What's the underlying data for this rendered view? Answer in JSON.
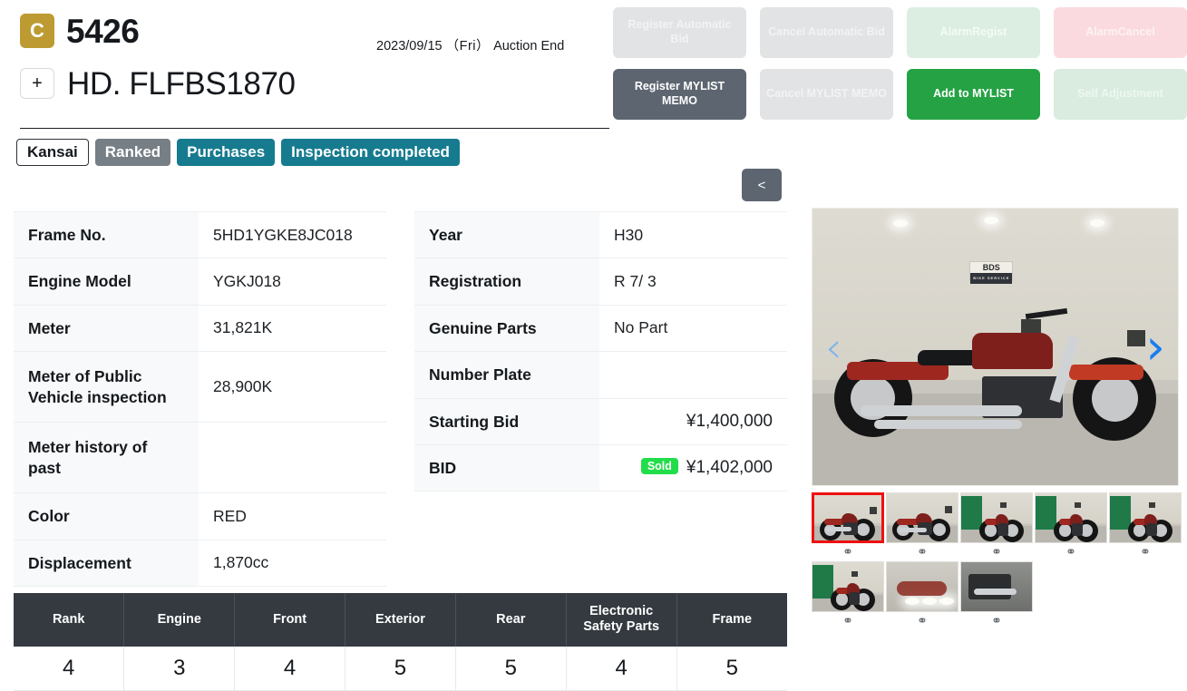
{
  "header": {
    "grade_badge": "C",
    "lot_number": "5426",
    "expand_button": "+",
    "model_name": "HD. FLFBS1870",
    "auction_date": "2023/09/15",
    "auction_day": "（Fri）",
    "auction_status": "Auction End"
  },
  "actions": [
    {
      "label": "Register Automatic Bid",
      "style": "act-grey",
      "name": "register-automatic-bid-button"
    },
    {
      "label": "Cancel Automatic Bid",
      "style": "act-grey",
      "name": "cancel-automatic-bid-button"
    },
    {
      "label": "AlarmRegist",
      "style": "act-green-l",
      "name": "alarm-regist-button"
    },
    {
      "label": "AlarmCancel",
      "style": "act-pink",
      "name": "alarm-cancel-button"
    },
    {
      "label": "Register MYLIST MEMO",
      "style": "act-dark",
      "name": "register-mylist-memo-button"
    },
    {
      "label": "Cancel MYLIST MEMO",
      "style": "act-grey",
      "name": "cancel-mylist-memo-button"
    },
    {
      "label": "Add to MYLIST",
      "style": "act-green",
      "name": "add-to-mylist-button"
    },
    {
      "label": "Self Adjustment",
      "style": "act-green-l2",
      "name": "self-adjustment-button"
    }
  ],
  "tags": [
    {
      "label": "Kansai",
      "style": "tag-outline",
      "name": "tag-region"
    },
    {
      "label": "Ranked",
      "style": "tag-grey",
      "name": "tag-ranked"
    },
    {
      "label": "Purchases",
      "style": "tag-teal",
      "name": "tag-purchases"
    },
    {
      "label": "Inspection completed",
      "style": "tag-teal",
      "name": "tag-inspection-completed"
    }
  ],
  "collapse_button": "<",
  "spec_left": [
    {
      "key": "Frame No.",
      "value": "5HD1YGKE8JC018",
      "tall": false
    },
    {
      "key": "Engine Model",
      "value": "YGKJ018",
      "tall": false
    },
    {
      "key": "Meter",
      "value": "31,821K",
      "tall": false
    },
    {
      "key": "Meter of Public Vehicle inspection",
      "value": "28,900K",
      "tall": true
    },
    {
      "key": "Meter history of past",
      "value": "",
      "tall": true
    },
    {
      "key": "Color",
      "value": "RED",
      "tall": false
    },
    {
      "key": "Displacement",
      "value": "1,870cc",
      "tall": false
    }
  ],
  "spec_right": [
    {
      "key": "Year",
      "value": "H30",
      "align": "left"
    },
    {
      "key": "Registration",
      "value": "R 7/ 3",
      "align": "left"
    },
    {
      "key": "Genuine Parts",
      "value": "No Part",
      "align": "left"
    },
    {
      "key": "Number Plate",
      "value": "",
      "align": "left"
    },
    {
      "key": "Starting Bid",
      "value": "¥1,400,000",
      "align": "right"
    },
    {
      "key": "BID",
      "value": "¥1,402,000",
      "align": "right",
      "badge": "Sold"
    }
  ],
  "rank_table": {
    "headers": [
      "Rank",
      "Engine",
      "Front",
      "Exterior",
      "Rear",
      "Electronic Safety Parts",
      "Frame"
    ],
    "values": [
      "4",
      "3",
      "4",
      "5",
      "5",
      "4",
      "5"
    ]
  },
  "gallery": {
    "prev_arrow": "‹",
    "next_arrow": "›",
    "link_icon": "⚭",
    "thumbnails": [
      {
        "selected": true,
        "scene": "beige"
      },
      {
        "selected": false,
        "scene": "beige"
      },
      {
        "selected": false,
        "scene": "green"
      },
      {
        "selected": false,
        "scene": "green"
      },
      {
        "selected": false,
        "scene": "green"
      },
      {
        "selected": false,
        "scene": "green"
      },
      {
        "selected": false,
        "scene": "top"
      },
      {
        "selected": false,
        "scene": "detail"
      }
    ]
  },
  "colors": {
    "grade_badge": "#bd9b32",
    "tag_teal": "#177b8f",
    "tag_grey": "#777f86",
    "mylist_green": "#25a244",
    "sold_green": "#22dd4a",
    "dark_button": "#5d6570",
    "rank_header": "#343a40",
    "arrow_blue": "#1a7cf0"
  }
}
